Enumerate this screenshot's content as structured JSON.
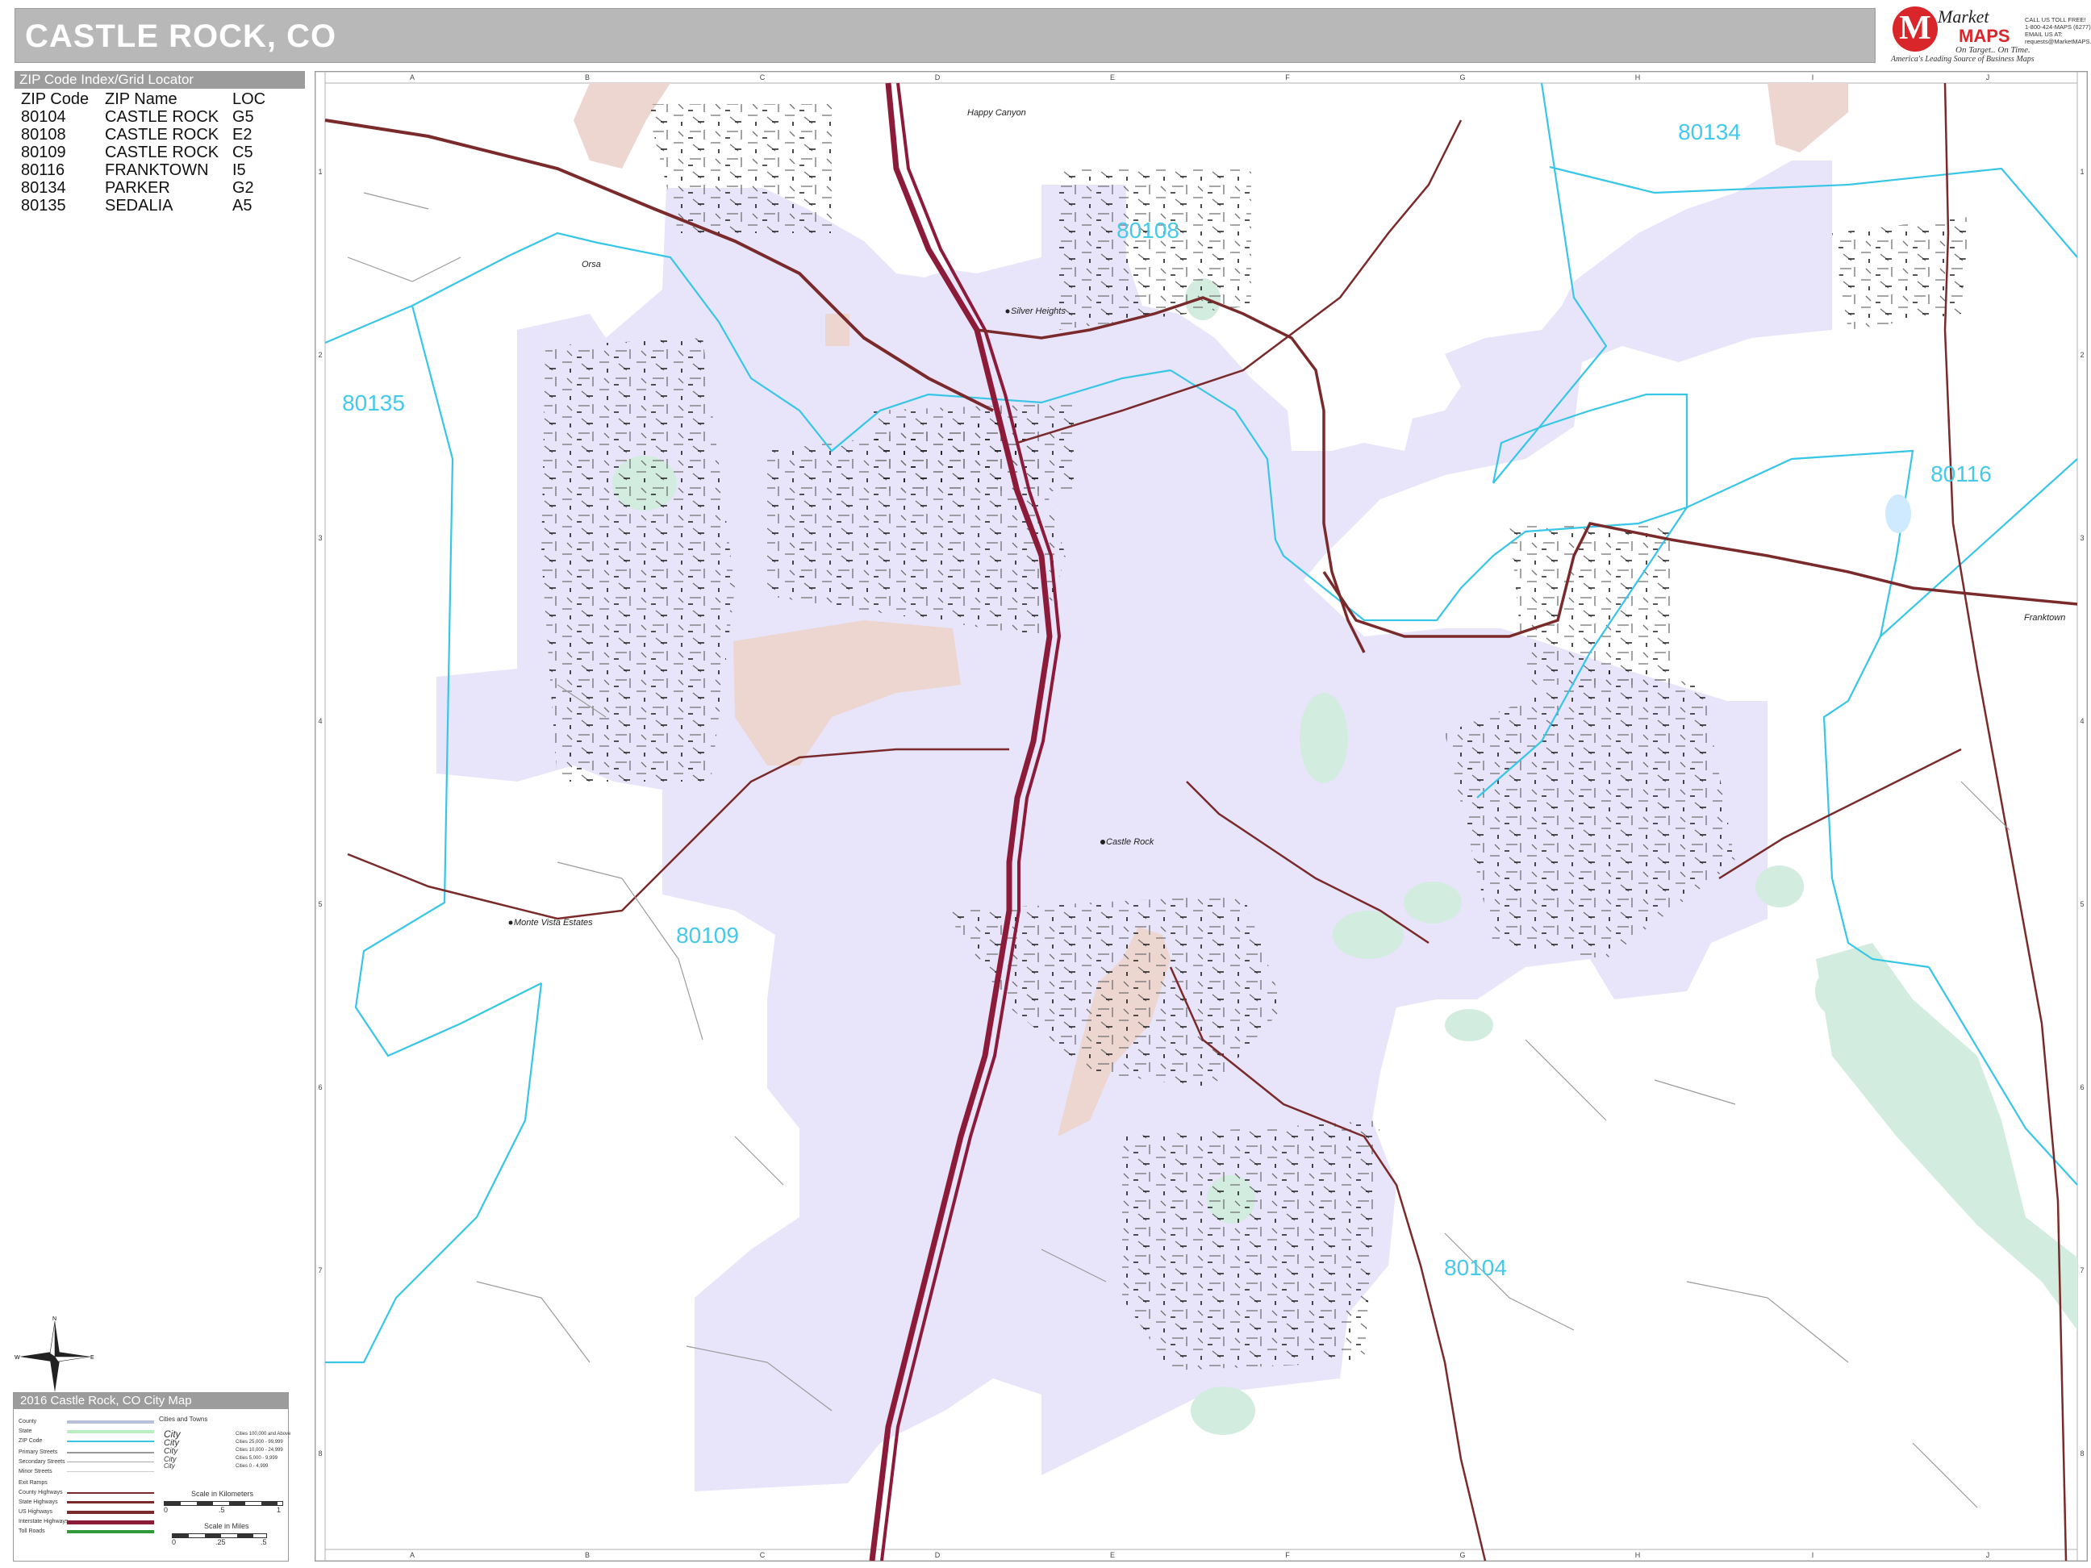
{
  "title": "CASTLE ROCK, CO",
  "logo": {
    "brand_word_1": "Market",
    "brand_word_2": "MAPS",
    "letter": "M",
    "tagline": "On Target.. On Time.",
    "source_line": "America's Leading Source of Business Maps",
    "contact_lines": [
      "CALL US TOLL FREE!",
      "1-800-424-MAPS (6277)",
      "EMAIL US AT:",
      "requests@MarketMAPS.com"
    ],
    "brand_color": "#d8262b"
  },
  "zip_index": {
    "header": "ZIP Code Index/Grid Locator",
    "columns": [
      "ZIP Code",
      "ZIP Name",
      "LOC"
    ],
    "rows": [
      [
        "80104",
        "CASTLE ROCK",
        "G5"
      ],
      [
        "80108",
        "CASTLE ROCK",
        "E2"
      ],
      [
        "80109",
        "CASTLE ROCK",
        "C5"
      ],
      [
        "80116",
        "FRANKTOWN",
        "I5"
      ],
      [
        "80134",
        "PARKER",
        "G2"
      ],
      [
        "80135",
        "SEDALIA",
        "A5"
      ]
    ]
  },
  "map": {
    "grid_columns": [
      "A",
      "B",
      "C",
      "D",
      "E",
      "F",
      "G",
      "H",
      "I",
      "J"
    ],
    "grid_rows": [
      "1",
      "2",
      "3",
      "4",
      "5",
      "6",
      "7",
      "8"
    ],
    "zip_labels": [
      "80108",
      "80134",
      "80135",
      "80116",
      "80109",
      "80104"
    ],
    "place_labels": [
      "Happy Canyon",
      "Silver Heights",
      "Castle Rock",
      "Monte Vista Estates",
      "Franktown",
      "Orsa"
    ],
    "colors": {
      "city_area": "#e8e4fa",
      "park": "#d2ecdf",
      "golf": "#ecd6cf",
      "zip_boundary": "#37c6e6",
      "zip_label": "#46c8e8",
      "interstate": "#8c1b3a",
      "highway": "#7a2a2a",
      "street": "#7d7d7d"
    }
  },
  "compass": {
    "n": "N",
    "s": "S",
    "e": "E",
    "w": "W"
  },
  "legend": {
    "header": "2016 Castle Rock, CO City Map",
    "items": [
      "County",
      "State",
      "ZIP Code",
      "Primary Streets",
      "Secondary Streets",
      "Minor Streets",
      "Exit Ramps",
      "County Highways",
      "State Highways",
      "US Highways",
      "Interstate Highways",
      "Toll Roads"
    ],
    "cities_title": "Cities and Towns",
    "city_samples": [
      "City",
      "City",
      "City",
      "City",
      "City"
    ],
    "population_classes": [
      "Cities 100,000 and Above",
      "Cities 25,000 - 99,999",
      "Cities 10,000 - 24,999",
      "Cities 5,000 - 9,999",
      "Cities 0 - 4,999"
    ],
    "scale_km_label": "Scale in Kilometers",
    "scale_mi_label": "Scale in Miles",
    "scale_km_ticks": [
      "0",
      ".5",
      "1"
    ],
    "scale_mi_ticks": [
      "0",
      ".25",
      ".5"
    ]
  }
}
